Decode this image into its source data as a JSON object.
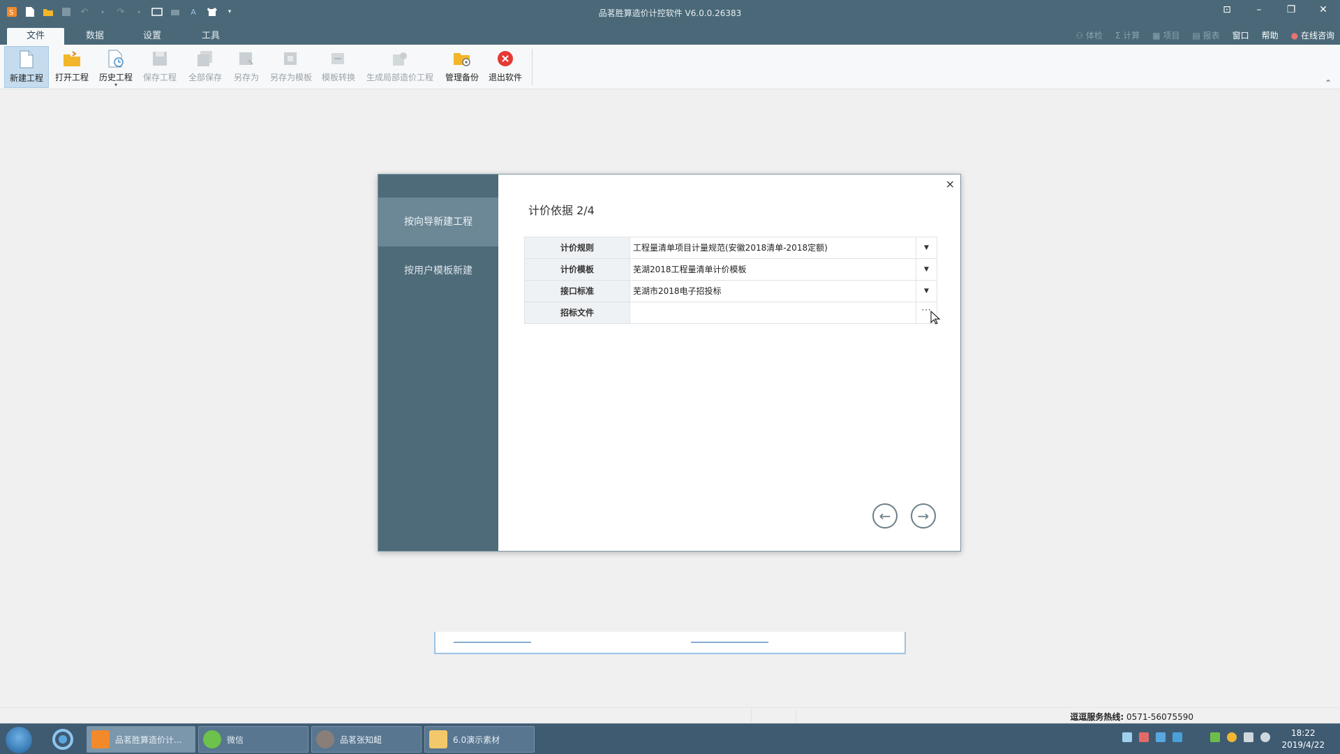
{
  "app": {
    "title": "品茗胜算造价计控软件 V6.0.0.26383"
  },
  "menu_tabs": [
    {
      "label": "文件",
      "active": true
    },
    {
      "label": "数据",
      "active": false
    },
    {
      "label": "设置",
      "active": false
    },
    {
      "label": "工具",
      "active": false
    }
  ],
  "right_menu": {
    "check": "体检",
    "calc": "计算",
    "project": "项目",
    "report": "报表",
    "window": "窗口",
    "help": "帮助",
    "consult": "在线咨询"
  },
  "ribbon": {
    "new_project": "新建工程",
    "open_project": "打开工程",
    "history_project": "历史工程",
    "save_project": "保存工程",
    "save_all": "全部保存",
    "save_as": "另存为",
    "save_as_template": "另存为模板",
    "template_convert": "模板转换",
    "generate_partial": "生成局部造价工程",
    "manage_backup": "管理备份",
    "exit": "退出软件"
  },
  "dialog": {
    "sidebar": [
      {
        "label": "按向导新建工程",
        "selected": true
      },
      {
        "label": "按用户模板新建",
        "selected": false
      }
    ],
    "title": "计价依据 2/4",
    "rows": [
      {
        "label": "计价规则",
        "value": "工程量清单项目计量规范(安徽2018清单-2018定额)",
        "control": "▼"
      },
      {
        "label": "计价模板",
        "value": "芜湖2018工程量清单计价模板",
        "control": "▼"
      },
      {
        "label": "接口标准",
        "value": "芜湖市2018电子招投标",
        "control": "▼"
      },
      {
        "label": "招标文件",
        "value": "",
        "control": "···"
      }
    ],
    "close": "×",
    "back": "←",
    "next": "→"
  },
  "status": {
    "hotline_label": "逗逗服务热线:",
    "hotline_number": "0571-56075590"
  },
  "taskbar": {
    "tasks": [
      {
        "label": "品茗胜算造价计..."
      },
      {
        "label": "微信"
      },
      {
        "label": "品茗张知衄"
      },
      {
        "label": "6.0演示素材"
      }
    ],
    "time": "18:22",
    "date": "2019/4/22"
  },
  "colors": {
    "titlebar": "#4a6878",
    "sidebar": "#4e6b79",
    "sidebar_selected": "#6c8897",
    "taskbar": "#3f5b72",
    "exit_red": "#e53935",
    "folder_yellow": "#f3b52a"
  }
}
